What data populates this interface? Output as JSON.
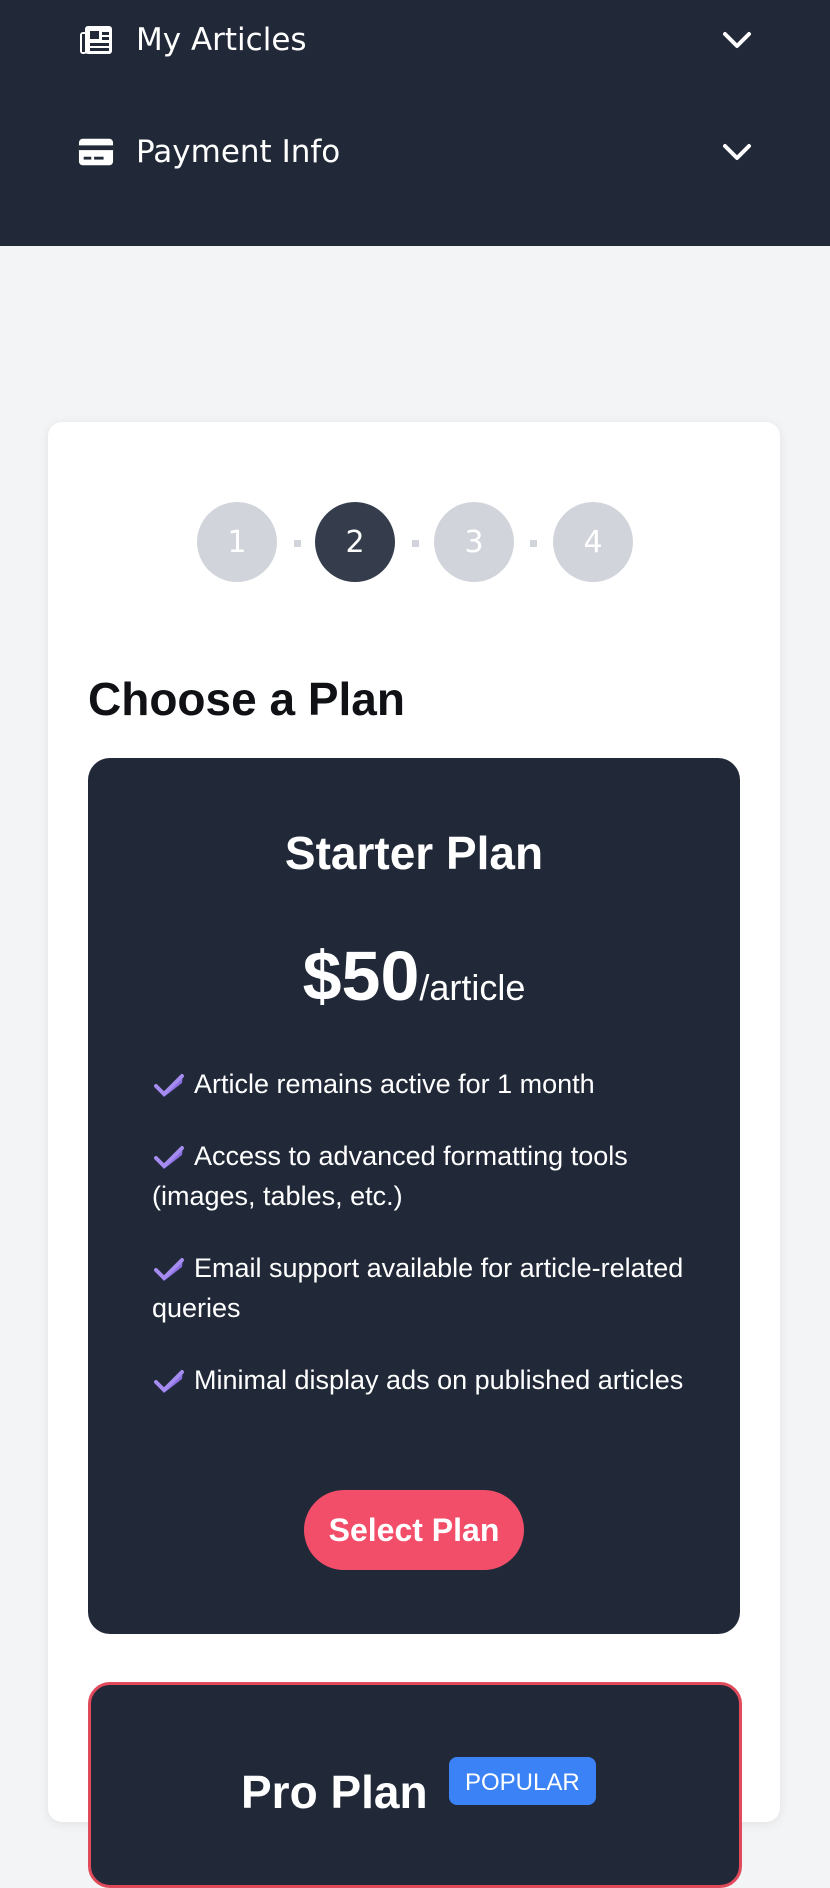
{
  "nav": {
    "items": [
      {
        "label": "My Articles",
        "icon": "newspaper-icon"
      },
      {
        "label": "Payment Info",
        "icon": "credit-card-icon"
      }
    ]
  },
  "wizard": {
    "steps": [
      "1",
      "2",
      "3",
      "4"
    ],
    "current_step": 2,
    "title": "Choose a Plan"
  },
  "plans": [
    {
      "name": "Starter Plan",
      "price": "$50",
      "unit": "/article",
      "features": [
        "Article remains active for 1 month",
        "Access to advanced formatting tools (images, tables, etc.)",
        "Email support available for article-related queries",
        "Minimal display ads on published articles"
      ],
      "button_label": "Select Plan"
    },
    {
      "name": "Pro Plan",
      "badge": "POPULAR"
    }
  ],
  "colors": {
    "nav_bg": "#212938",
    "page_bg": "#f3f4f6",
    "card_bg": "#212938",
    "accent_button": "#f24e6a",
    "step_active": "#353d4d",
    "step_inactive": "#d1d5db",
    "check": "#8b6fe0",
    "badge": "#3b82f6",
    "pro_border": "#e04a5b"
  }
}
